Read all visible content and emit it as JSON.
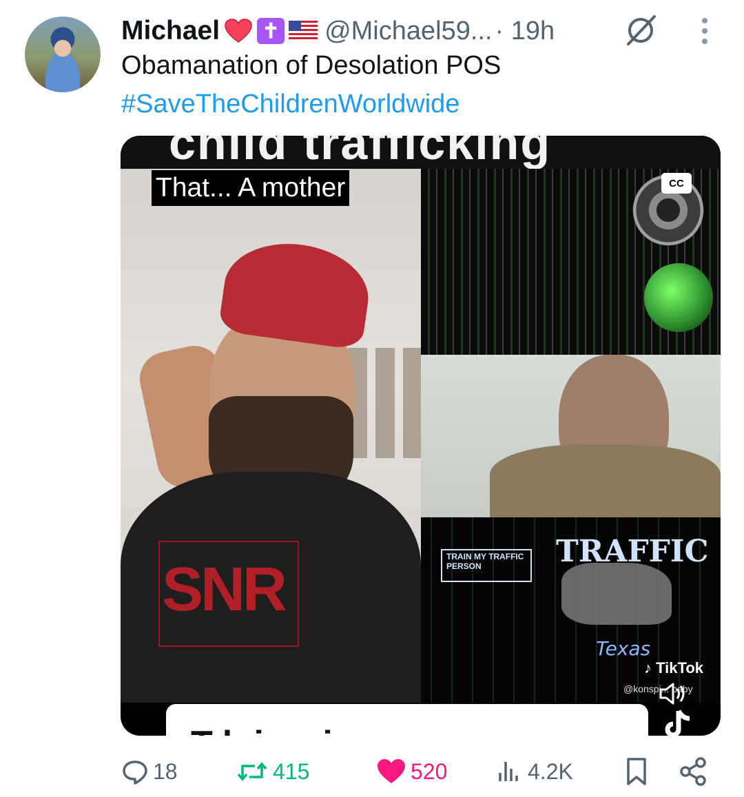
{
  "tweet": {
    "author_name": "Michael",
    "author_emojis": [
      "heart-emoji",
      "latin-cross-emoji",
      "us-flag-emoji"
    ],
    "handle": "@Michael59...",
    "time": "· 19h",
    "text_line": "Obamanation of Desolation POS",
    "hashtag": "#SaveTheChildrenWorldwide"
  },
  "media": {
    "caption": "That... A mother",
    "cc_label": "CC",
    "overlay_text_train": "TRAIN MY TRAFFIC PERSON",
    "overlay_text_traffic": "TRAFFIC",
    "overlay_text_texas": "Texas",
    "tiktok_label": "TikTok",
    "tiktok_handle": "@konspi... baby",
    "shirt_logo": "SNR",
    "bottom_text": "This is...",
    "top_ghost_text": "child trafficking"
  },
  "actions": {
    "replies": "18",
    "retweets": "415",
    "likes": "520",
    "views": "4.2K"
  },
  "colors": {
    "accent": "#1d9bf0",
    "like": "#f91880",
    "retweet": "#00ba7c",
    "muted": "#536471",
    "cross_badge": "#a855f7"
  }
}
